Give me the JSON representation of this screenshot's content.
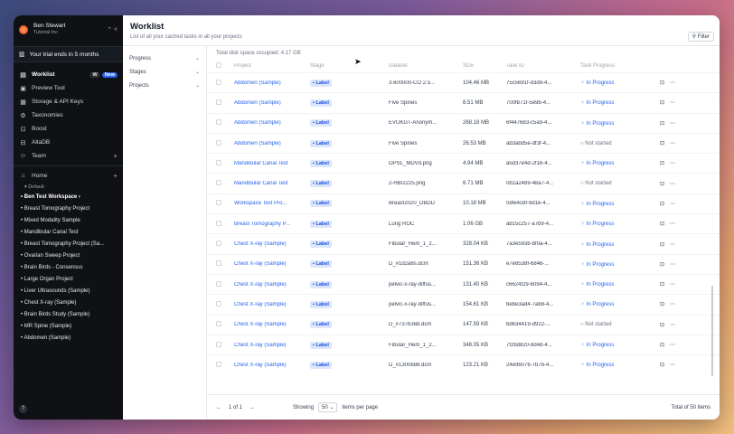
{
  "sidebar": {
    "user_name": "Ben Stewart",
    "org_name": "Tutorial Inc",
    "toggle": "«",
    "trial_text": "Your trial ends in 5 months",
    "nav": [
      {
        "label": "Worklist",
        "icon": "worklist-icon",
        "glyph": "▤",
        "kbd": "W",
        "badge": "New",
        "active": true
      },
      {
        "label": "Preview Tool",
        "icon": "preview-icon",
        "glyph": "▣"
      },
      {
        "label": "Storage & API Keys",
        "icon": "storage-icon",
        "glyph": "▦"
      },
      {
        "label": "Taxonomies",
        "icon": "taxonomy-icon",
        "glyph": "⚙"
      },
      {
        "label": "Boost",
        "icon": "boost-icon",
        "glyph": "⊡"
      },
      {
        "label": "AltaDB",
        "icon": "database-icon",
        "glyph": "⊟"
      },
      {
        "label": "Team",
        "icon": "team-icon",
        "glyph": "☺",
        "plus": true
      }
    ],
    "home": {
      "label": "Home",
      "icon": "home-icon",
      "glyph": "⌂"
    },
    "workspace_label": "Default",
    "workspace_items": [
      "Ben Test Workspace",
      "Breast Tomography Project",
      "Mixed Modality Sample",
      "Mandibular Canal Test",
      "Breast Tomography Project (Sa...",
      "Ovarian Sweep Project",
      "Brain Birds - Consensus",
      "Large Organ Project",
      "Liver Ultrasounds (Sample)",
      "Chest X-ray (Sample)",
      "Brain Birds Study (Sample)",
      "MR Spine (Sample)",
      "Abdomen (Sample)"
    ],
    "help": "?"
  },
  "header": {
    "title": "Worklist",
    "subtitle": "List of all your cached tasks in all your projects",
    "filter_label": "Filter"
  },
  "filters": [
    "Progress",
    "Stages",
    "Projects"
  ],
  "disk_space": "Total disk space occupied: 4.17 GB",
  "columns": [
    "Project",
    "Stage",
    "Dataset",
    "Size",
    "Task ID",
    "Task Progress"
  ],
  "rows": [
    {
      "project": "Abdomen (Sample)",
      "stage": "Label",
      "dataset": "3.600000-CO 2.5...",
      "size": "104.46 MB",
      "task": "75c5691f-d3d9-4...",
      "progress": "In Progress"
    },
    {
      "project": "Abdomen (Sample)",
      "stage": "Label",
      "dataset": "Five Spines",
      "size": "8.51 MB",
      "task": "700fb71f-5e9b-4...",
      "progress": "In Progress"
    },
    {
      "project": "Abdomen (Sample)",
      "stage": "Label",
      "dataset": "EVUKGT-Anonym...",
      "size": "268.18 MB",
      "task": "6f447683-c5a9-4...",
      "progress": "In Progress"
    },
    {
      "project": "Abdomen (Sample)",
      "stage": "Label",
      "dataset": "Five Spines",
      "size": "26.53 MB",
      "task": "ab3abd5e-df3f-4...",
      "progress": "Not started"
    },
    {
      "project": "Mandibular Canal Test",
      "stage": "Label",
      "dataset": "OPSL_MDVd.png",
      "size": "4.94 MB",
      "task": "a5d37e4d-2f16-4...",
      "progress": "In Progress"
    },
    {
      "project": "Mandibular Canal Test",
      "stage": "Label",
      "dataset": "2-HBI2225.png",
      "size": "6.71 MB",
      "task": "0b1a2489-48a7-4...",
      "progress": "Not started"
    },
    {
      "project": "Workspace Test Pro...",
      "stage": "Label",
      "dataset": "Breast2020_DBDD",
      "size": "10.18 MB",
      "task": "0dfe4c8f-9d1e-4...",
      "progress": "In Progress"
    },
    {
      "project": "Breast Tomography P...",
      "stage": "Label",
      "dataset": "Lung ROC",
      "size": "1.06 GB",
      "task": "ab15c257-a7b9-4...",
      "progress": "In Progress"
    },
    {
      "project": "Chest X-ray (Sample)",
      "stage": "Label",
      "dataset": "Fibular_Hem_1_2...",
      "size": "328.04 KB",
      "task": "7a3e593b-bf0a-4...",
      "progress": "In Progress"
    },
    {
      "project": "Chest X-ray (Sample)",
      "stage": "Label",
      "dataset": "D_#1d2a8s.dcm",
      "size": "151.36 KB",
      "task": "e7e8538f-6846-...",
      "progress": "In Progress"
    },
    {
      "project": "Chest X-ray (Sample)",
      "stage": "Label",
      "dataset": "pelvic-x-ray-diffus...",
      "size": "131.40 KB",
      "task": "c6624f29-6094-4...",
      "progress": "In Progress"
    },
    {
      "project": "Chest X-ray (Sample)",
      "stage": "Label",
      "dataset": "pelvic-x-ray-diffus...",
      "size": "154.61 KB",
      "task": "bebe3ad4-7ab8-4...",
      "progress": "In Progress"
    },
    {
      "project": "Chest X-ray (Sample)",
      "stage": "Label",
      "dataset": "D_#737b38d.dcm",
      "size": "147.59 KB",
      "task": "bd634419-d922-...",
      "progress": "Not started"
    },
    {
      "project": "Chest X-ray (Sample)",
      "stage": "Label",
      "dataset": "Fibular_Hem_1_2...",
      "size": "348.05 KB",
      "task": "7f2bd820-8d4d-4...",
      "progress": "In Progress"
    },
    {
      "project": "Chest X-ray (Sample)",
      "stage": "Label",
      "dataset": "D_#1300888.dcm",
      "size": "123.21 KB",
      "task": "24e9b076-7b7b-4...",
      "progress": "In Progress"
    }
  ],
  "footer": {
    "page_text": "1 of 1",
    "showing_label": "Showing",
    "per_page_value": "50",
    "items_label": "items per page",
    "total": "Total of 50 items"
  }
}
